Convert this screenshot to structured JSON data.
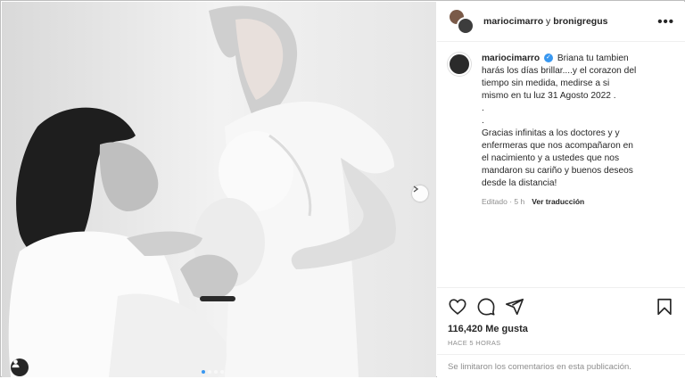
{
  "header": {
    "user1": "mariocimarro",
    "connector": " y ",
    "user2": "bronigregus",
    "more": "•••"
  },
  "caption": {
    "username": "mariocimarro",
    "verified_mark": "✓",
    "lines": [
      "Briana tu tambien",
      "harás los días brillar....y el corazon del",
      "tiempo sin medida, medirse a si",
      "mismo en tu luz 31 Agosto 2022 .",
      ".",
      ".",
      "Gracias infinitas a los doctores y y",
      "enfermeras que nos acompañaron en",
      "el nacimiento y a ustedes que nos",
      "mandaron su cariño y buenos deseos",
      "desde la distancia!"
    ],
    "edited": "Editado · 5 h",
    "translate": "Ver traducción"
  },
  "actions": {
    "like_icon": "heart-icon",
    "comment_icon": "comment-icon",
    "share_icon": "share-icon",
    "save_icon": "bookmark-icon"
  },
  "likes": "116,420 Me gusta",
  "time_ago": "HACE 5 HORAS",
  "comments_notice": "Se limitaron los comentarios en esta publicación.",
  "carousel": {
    "slides": 4,
    "active": 0
  },
  "colors": {
    "accent": "#3897f0",
    "text": "#262626",
    "muted": "#8e8e8e",
    "border": "#efefef"
  }
}
